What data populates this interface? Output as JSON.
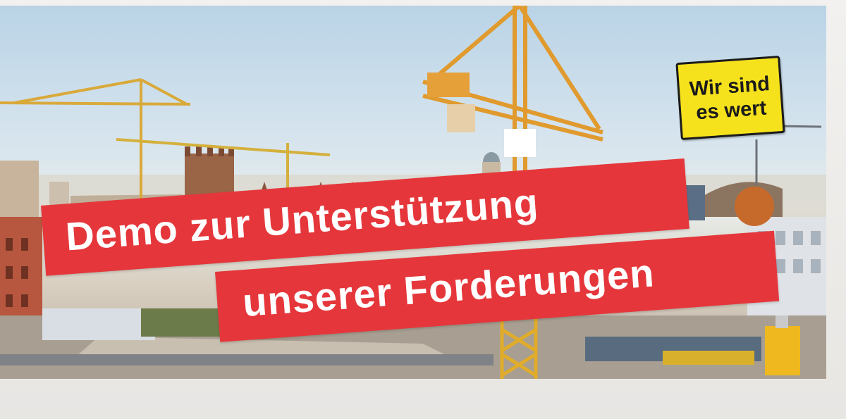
{
  "banner": {
    "line1": "Demo zur Unterstützung",
    "line2": "unserer Forderungen"
  },
  "sign": {
    "line1": "Wir sind",
    "line2": "es wert"
  },
  "colors": {
    "banner_red": "#e5373b",
    "banner_text": "#ffffff",
    "sign_yellow": "#f6e21c",
    "sign_text": "#1b1b1b",
    "crane_orange": "#e7a13a",
    "crane_yellow": "#d9b640",
    "sky_blue": "#b9d3e6"
  }
}
